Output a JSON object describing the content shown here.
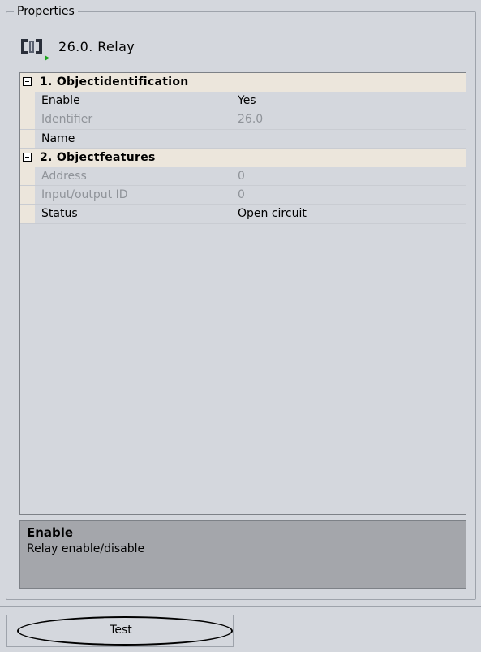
{
  "properties_group": {
    "title": "Properties"
  },
  "object": {
    "title": "26.0. Relay",
    "icon": "relay-icon"
  },
  "grid": {
    "categories": [
      {
        "label": "1. Objectidentification",
        "properties": [
          {
            "name": "Enable",
            "value": "Yes",
            "enabled": true
          },
          {
            "name": "Identifier",
            "value": "26.0",
            "enabled": false
          },
          {
            "name": "Name",
            "value": "",
            "enabled": true
          }
        ]
      },
      {
        "label": "2. Objectfeatures",
        "properties": [
          {
            "name": "Address",
            "value": "0",
            "enabled": false
          },
          {
            "name": "Input/output ID",
            "value": "0",
            "enabled": false
          },
          {
            "name": "Status",
            "value": "Open circuit",
            "enabled": true
          }
        ]
      }
    ]
  },
  "description": {
    "title": "Enable",
    "text": "Relay enable/disable"
  },
  "buttons": {
    "test": "Test"
  },
  "colors": {
    "background": "#d4d7dd",
    "category_band": "#ece6dc",
    "description_bg": "#a4a6ab",
    "icon_green": "#1aa31a"
  }
}
